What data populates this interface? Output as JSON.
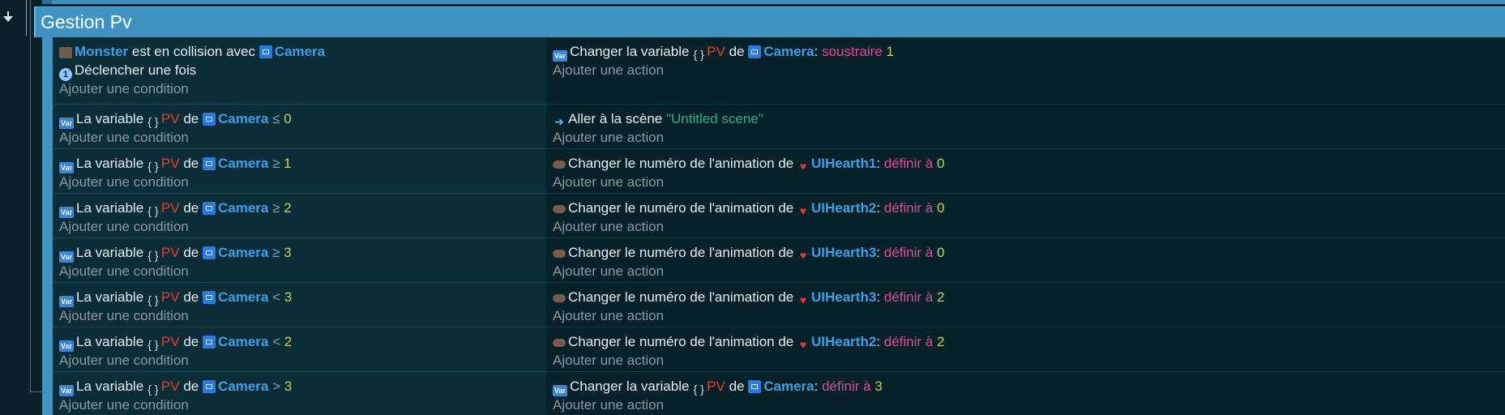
{
  "group": {
    "title": "Gestion Pv"
  },
  "labels": {
    "add_condition": "Ajouter une condition",
    "add_action": "Ajouter une action",
    "collides_with": "est en collision avec",
    "trigger_once": "Déclencher une fois",
    "the_variable": "La variable",
    "change_variable": "Changer la variable",
    "of": "de",
    "goto_scene": "Aller à la scène",
    "change_anim": "Changer le numéro de l'animation de",
    "var_icon_text": "Var",
    "once_icon_text": "1"
  },
  "objects": {
    "monster": "Monster",
    "camera": "Camera",
    "variable": "PV"
  },
  "events": [
    {
      "condition": {
        "type": "collision"
      },
      "action": {
        "type": "change_var",
        "op": "soustraire",
        "value": "1"
      }
    },
    {
      "condition": {
        "type": "var",
        "cmp": "≤",
        "value": "0"
      },
      "action": {
        "type": "goto",
        "scene": "\"Untitled scene\""
      }
    },
    {
      "condition": {
        "type": "var",
        "cmp": "≥",
        "value": "1"
      },
      "action": {
        "type": "anim",
        "object": "UIHearth1",
        "op": "définir à",
        "value": "0"
      }
    },
    {
      "condition": {
        "type": "var",
        "cmp": "≥",
        "value": "2"
      },
      "action": {
        "type": "anim",
        "object": "UIHearth2",
        "op": "définir à",
        "value": "0"
      }
    },
    {
      "condition": {
        "type": "var",
        "cmp": "≥",
        "value": "3"
      },
      "action": {
        "type": "anim",
        "object": "UIHearth3",
        "op": "définir à",
        "value": "0"
      }
    },
    {
      "condition": {
        "type": "var",
        "cmp": "<",
        "value": "3"
      },
      "action": {
        "type": "anim",
        "object": "UIHearth3",
        "op": "définir à",
        "value": "2"
      }
    },
    {
      "condition": {
        "type": "var",
        "cmp": "<",
        "value": "2"
      },
      "action": {
        "type": "anim",
        "object": "UIHearth2",
        "op": "définir à",
        "value": "2"
      }
    },
    {
      "condition": {
        "type": "var",
        "cmp": ">",
        "value": "3"
      },
      "action": {
        "type": "change_var",
        "op": "définir à",
        "value": "3"
      }
    }
  ],
  "colors": {
    "group_header": "#3f93c2",
    "condition_bg": "#0b2d38",
    "action_bg": "#072128",
    "object_name": "#3aa0e8",
    "variable_name": "#e0422d",
    "number": "#c7d44d",
    "operation": "#e04b99",
    "string": "#29b08e"
  }
}
